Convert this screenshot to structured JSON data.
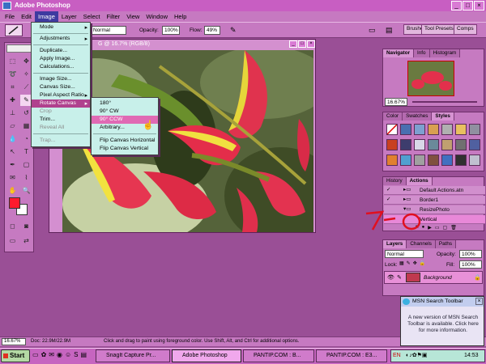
{
  "window": {
    "title": "Adobe Photoshop",
    "min": "_",
    "max": "□",
    "close": "×"
  },
  "menubar": [
    "File",
    "Edit",
    "Image",
    "Layer",
    "Select",
    "Filter",
    "View",
    "Window",
    "Help"
  ],
  "options": {
    "mode_value": "Normal",
    "opacity_label": "Opacity:",
    "opacity_value": "100%",
    "flow_label": "Flow:",
    "flow_value": "49%",
    "wells": [
      "Brushes",
      "Tool Presets",
      "Comps"
    ]
  },
  "document": {
    "title": "G @ 16.7% (RGB/8)"
  },
  "image_menu": {
    "items": [
      {
        "label": "Mode",
        "arrow": "▸",
        "disabled": false
      },
      {
        "label": "Adjustments",
        "arrow": "▸",
        "disabled": false
      },
      {
        "label": "Duplicate...",
        "arrow": "",
        "disabled": false
      },
      {
        "label": "Apply Image...",
        "arrow": "",
        "disabled": false
      },
      {
        "label": "Calculations...",
        "arrow": "",
        "disabled": false
      },
      {
        "label": "Image Size...",
        "arrow": "",
        "disabled": false
      },
      {
        "label": "Canvas Size...",
        "arrow": "",
        "disabled": false
      },
      {
        "label": "Pixel Aspect Ratio",
        "arrow": "▸",
        "disabled": false
      },
      {
        "label": "Rotate Canvas",
        "arrow": "▸",
        "disabled": false
      },
      {
        "label": "Crop",
        "arrow": "",
        "disabled": true
      },
      {
        "label": "Trim...",
        "arrow": "",
        "disabled": false
      },
      {
        "label": "Reveal All",
        "arrow": "",
        "disabled": true
      },
      {
        "label": "Trap...",
        "arrow": "",
        "disabled": true
      }
    ]
  },
  "rotate_submenu": {
    "items": [
      "180°",
      "90° CW",
      "90° CCW",
      "Arbitrary...",
      "Flip Canvas Horizontal",
      "Flip Canvas Vertical"
    ]
  },
  "navigator": {
    "tabs": [
      "Navigator",
      "Info",
      "Histogram"
    ],
    "zoom": "16.67%"
  },
  "styles": {
    "tabs": [
      "Color",
      "Swatches",
      "Styles"
    ]
  },
  "actions": {
    "tabs": [
      "History",
      "Actions"
    ],
    "rows": [
      "Default Actions.atn",
      "Border1",
      "ResizePhoto",
      "Vertical"
    ]
  },
  "layers": {
    "tabs": [
      "Layers",
      "Channels",
      "Paths"
    ],
    "blend": "Normal",
    "opacity_label": "Opacity:",
    "opacity_value": "100%",
    "lock_label": "Lock:",
    "fill_label": "Fill:",
    "fill_value": "100%",
    "layer_name": "Background"
  },
  "status": {
    "zoom": "16.67%",
    "doc": "Doc: 22.9M/22.9M",
    "hint": "Click and drag to paint using foreground color. Use Shift, Alt, and Ctrl for additional options."
  },
  "taskbar": {
    "start": "Start",
    "tasks": [
      "SnagIt Capture Pr...",
      "Adobe Photoshop",
      "PANTIP.COM : B...",
      "PANTIP.COM : E3..."
    ],
    "lang": "EN",
    "clock": "14:53"
  },
  "msn": {
    "title": "MSN Search Toolbar",
    "message": "A new version of MSN Search Toolbar is available. Click here for more information."
  },
  "colors": {
    "accent": "#c679c1",
    "foreground": "#ff1a2e",
    "background": "#ffffff"
  }
}
